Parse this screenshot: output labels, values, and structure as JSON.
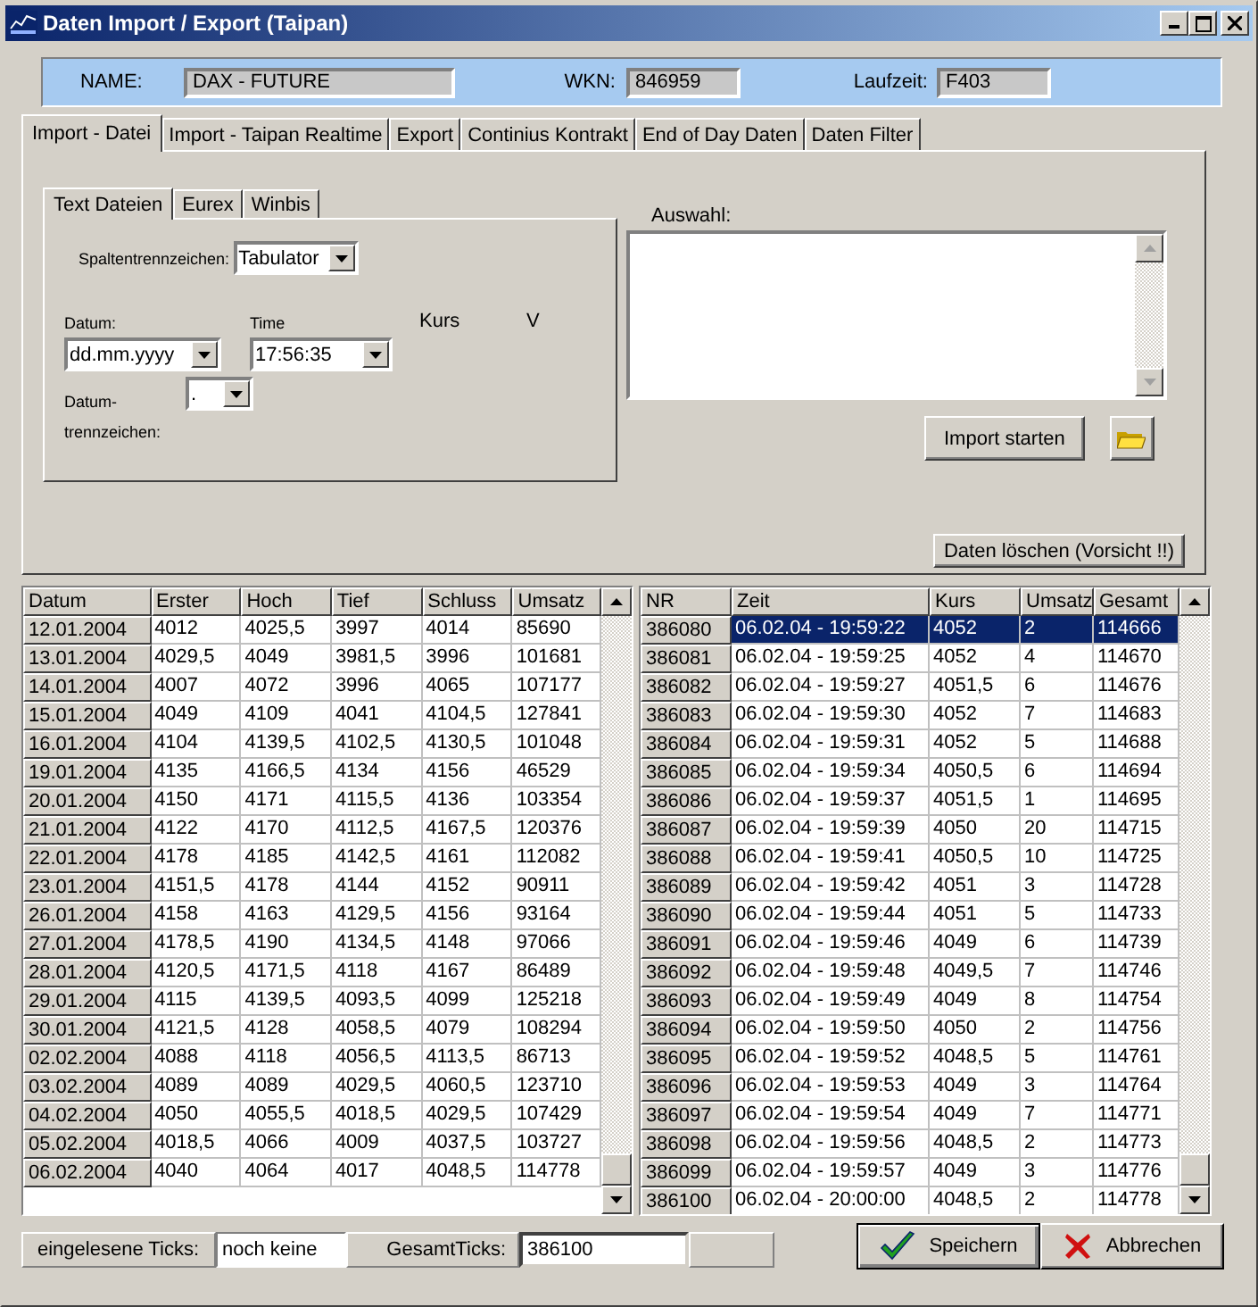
{
  "window": {
    "title": "Daten Import / Export (Taipan)"
  },
  "info_bar": [
    {
      "label": "NAME:",
      "value": "DAX - FUTURE"
    },
    {
      "label": "WKN:",
      "value": "846959"
    },
    {
      "label": "Laufzeit:",
      "value": "F403"
    }
  ],
  "tabs": [
    {
      "label": "Import - Datei",
      "selected": true
    },
    {
      "label": "Import - Taipan Realtime",
      "selected": false
    },
    {
      "label": "Export",
      "selected": false
    },
    {
      "label": "Continius Kontrakt",
      "selected": false
    },
    {
      "label": "End of Day Daten",
      "selected": false
    },
    {
      "label": "Daten Filter",
      "selected": false
    }
  ],
  "sub_tabs": [
    {
      "label": "Text Dateien",
      "selected": true
    },
    {
      "label": "Eurex",
      "selected": false
    },
    {
      "label": "Winbis",
      "selected": false
    }
  ],
  "import_form": {
    "column_separator": {
      "label": "Spaltentrennzeichen:",
      "value": "Tabulator"
    },
    "date": {
      "label": "Datum:",
      "value": "dd.mm.yyyy"
    },
    "time": {
      "label": "Time",
      "value": "17:56:35"
    },
    "kurs_label": "Kurs",
    "v_label": "V",
    "date_separator": {
      "label": "Datum-trennzeichen:",
      "value": "."
    }
  },
  "selection": {
    "label": "Auswahl:"
  },
  "buttons": {
    "import": "Import starten",
    "delete": "Daten löschen (Vorsicht !!)",
    "save": "Speichern",
    "cancel": "Abbrechen"
  },
  "daily_table": {
    "columns": [
      "Datum",
      "Erster",
      "Hoch",
      "Tief",
      "Schluss",
      "Umsatz"
    ],
    "rows": [
      [
        "12.01.2004",
        "4012",
        "4025,5",
        "3997",
        "4014",
        "85690"
      ],
      [
        "13.01.2004",
        "4029,5",
        "4049",
        "3981,5",
        "3996",
        "101681"
      ],
      [
        "14.01.2004",
        "4007",
        "4072",
        "3996",
        "4065",
        "107177"
      ],
      [
        "15.01.2004",
        "4049",
        "4109",
        "4041",
        "4104,5",
        "127841"
      ],
      [
        "16.01.2004",
        "4104",
        "4139,5",
        "4102,5",
        "4130,5",
        "101048"
      ],
      [
        "19.01.2004",
        "4135",
        "4166,5",
        "4134",
        "4156",
        "46529"
      ],
      [
        "20.01.2004",
        "4150",
        "4171",
        "4115,5",
        "4136",
        "103354"
      ],
      [
        "21.01.2004",
        "4122",
        "4170",
        "4112,5",
        "4167,5",
        "120376"
      ],
      [
        "22.01.2004",
        "4178",
        "4185",
        "4142,5",
        "4161",
        "112082"
      ],
      [
        "23.01.2004",
        "4151,5",
        "4178",
        "4144",
        "4152",
        "90911"
      ],
      [
        "26.01.2004",
        "4158",
        "4163",
        "4129,5",
        "4156",
        "93164"
      ],
      [
        "27.01.2004",
        "4178,5",
        "4190",
        "4134,5",
        "4148",
        "97066"
      ],
      [
        "28.01.2004",
        "4120,5",
        "4171,5",
        "4118",
        "4167",
        "86489"
      ],
      [
        "29.01.2004",
        "4115",
        "4139,5",
        "4093,5",
        "4099",
        "125218"
      ],
      [
        "30.01.2004",
        "4121,5",
        "4128",
        "4058,5",
        "4079",
        "108294"
      ],
      [
        "02.02.2004",
        "4088",
        "4118",
        "4056,5",
        "4113,5",
        "86713"
      ],
      [
        "03.02.2004",
        "4089",
        "4089",
        "4029,5",
        "4060,5",
        "123710"
      ],
      [
        "04.02.2004",
        "4050",
        "4055,5",
        "4018,5",
        "4029,5",
        "107429"
      ],
      [
        "05.02.2004",
        "4018,5",
        "4066",
        "4009",
        "4037,5",
        "103727"
      ],
      [
        "06.02.2004",
        "4040",
        "4064",
        "4017",
        "4048,5",
        "114778"
      ]
    ]
  },
  "tick_table": {
    "columns": [
      "NR",
      "Zeit",
      "Kurs",
      "Umsatz",
      "Gesamt"
    ],
    "rows": [
      {
        "cells": [
          "386080",
          "06.02.04 - 19:59:22",
          "4052",
          "2",
          "114666"
        ],
        "selected": true
      },
      {
        "cells": [
          "386081",
          "06.02.04 - 19:59:25",
          "4052",
          "4",
          "114670"
        ],
        "selected": false
      },
      {
        "cells": [
          "386082",
          "06.02.04 - 19:59:27",
          "4051,5",
          "6",
          "114676"
        ],
        "selected": false
      },
      {
        "cells": [
          "386083",
          "06.02.04 - 19:59:30",
          "4052",
          "7",
          "114683"
        ],
        "selected": false
      },
      {
        "cells": [
          "386084",
          "06.02.04 - 19:59:31",
          "4052",
          "5",
          "114688"
        ],
        "selected": false
      },
      {
        "cells": [
          "386085",
          "06.02.04 - 19:59:34",
          "4050,5",
          "6",
          "114694"
        ],
        "selected": false
      },
      {
        "cells": [
          "386086",
          "06.02.04 - 19:59:37",
          "4051,5",
          "1",
          "114695"
        ],
        "selected": false
      },
      {
        "cells": [
          "386087",
          "06.02.04 - 19:59:39",
          "4050",
          "20",
          "114715"
        ],
        "selected": false
      },
      {
        "cells": [
          "386088",
          "06.02.04 - 19:59:41",
          "4050,5",
          "10",
          "114725"
        ],
        "selected": false
      },
      {
        "cells": [
          "386089",
          "06.02.04 - 19:59:42",
          "4051",
          "3",
          "114728"
        ],
        "selected": false
      },
      {
        "cells": [
          "386090",
          "06.02.04 - 19:59:44",
          "4051",
          "5",
          "114733"
        ],
        "selected": false
      },
      {
        "cells": [
          "386091",
          "06.02.04 - 19:59:46",
          "4049",
          "6",
          "114739"
        ],
        "selected": false
      },
      {
        "cells": [
          "386092",
          "06.02.04 - 19:59:48",
          "4049,5",
          "7",
          "114746"
        ],
        "selected": false
      },
      {
        "cells": [
          "386093",
          "06.02.04 - 19:59:49",
          "4049",
          "8",
          "114754"
        ],
        "selected": false
      },
      {
        "cells": [
          "386094",
          "06.02.04 - 19:59:50",
          "4050",
          "2",
          "114756"
        ],
        "selected": false
      },
      {
        "cells": [
          "386095",
          "06.02.04 - 19:59:52",
          "4048,5",
          "5",
          "114761"
        ],
        "selected": false
      },
      {
        "cells": [
          "386096",
          "06.02.04 - 19:59:53",
          "4049",
          "3",
          "114764"
        ],
        "selected": false
      },
      {
        "cells": [
          "386097",
          "06.02.04 - 19:59:54",
          "4049",
          "7",
          "114771"
        ],
        "selected": false
      },
      {
        "cells": [
          "386098",
          "06.02.04 - 19:59:56",
          "4048,5",
          "2",
          "114773"
        ],
        "selected": false
      },
      {
        "cells": [
          "386099",
          "06.02.04 - 19:59:57",
          "4049",
          "3",
          "114776"
        ],
        "selected": false
      },
      {
        "cells": [
          "386100",
          "06.02.04 - 20:00:00",
          "4048,5",
          "2",
          "114778"
        ],
        "selected": false
      }
    ]
  },
  "status_bar": {
    "ticks_label": "eingelesene Ticks:",
    "ticks_value": "noch keine",
    "total_label": "GesamtTicks:",
    "total_value": "386100"
  }
}
